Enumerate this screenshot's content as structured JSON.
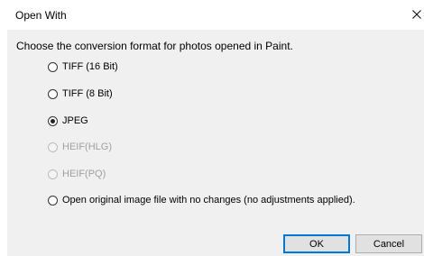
{
  "window": {
    "title": "Open With",
    "close_icon": "close-icon"
  },
  "prompt": "Choose the conversion format for photos opened in Paint.",
  "options": [
    {
      "label": "TIFF (16 Bit)",
      "checked": false,
      "enabled": true
    },
    {
      "label": "TIFF (8 Bit)",
      "checked": false,
      "enabled": true
    },
    {
      "label": "JPEG",
      "checked": true,
      "enabled": true
    },
    {
      "label": "HEIF(HLG)",
      "checked": false,
      "enabled": false
    },
    {
      "label": "HEIF(PQ)",
      "checked": false,
      "enabled": false
    },
    {
      "label": "Open original image file with no changes (no adjustments applied).",
      "checked": false,
      "enabled": true
    }
  ],
  "buttons": {
    "ok_label": "OK",
    "cancel_label": "Cancel"
  },
  "colors": {
    "client_bg": "#f0f0f0",
    "default_button_border": "#0078d7"
  }
}
